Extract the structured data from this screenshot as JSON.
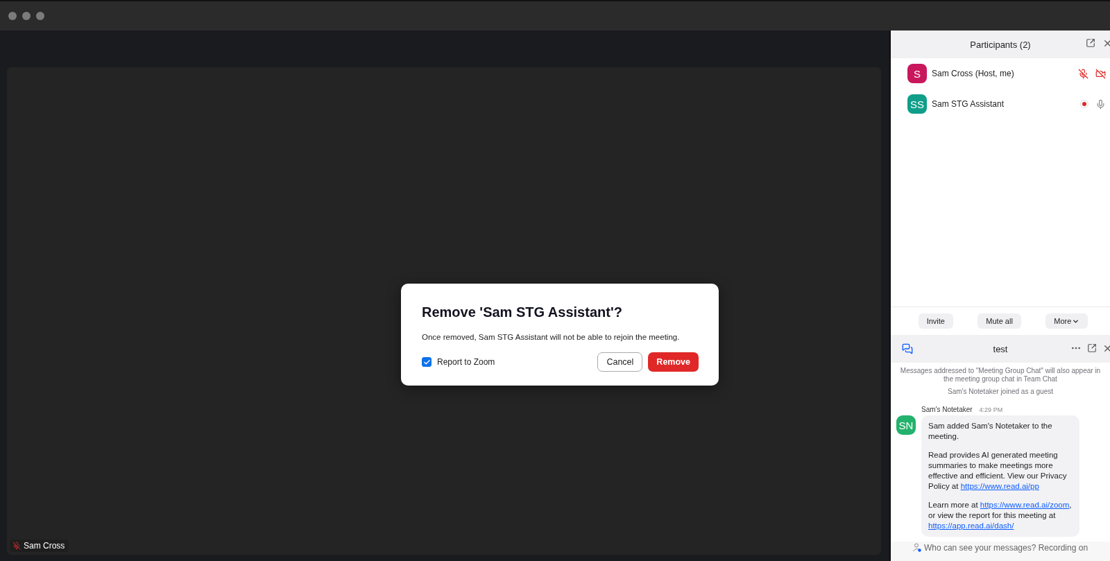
{
  "video": {
    "name": "Sam Cross",
    "muted": true
  },
  "dialog": {
    "title": "Remove 'Sam STG Assistant'?",
    "message": "Once removed, Sam STG Assistant will not be able to rejoin the meeting.",
    "checkbox": {
      "label": "Report to Zoom",
      "checked": true
    },
    "buttons": [
      {
        "label": "Cancel",
        "kind": "secondary"
      },
      {
        "label": "Remove",
        "kind": "danger"
      }
    ]
  },
  "participants": {
    "title": "Participants (2)",
    "items": [
      {
        "initials": "S",
        "name": "Sam Cross (Host, me)",
        "color": "#c8175d",
        "recording": false,
        "muted": true,
        "video_off": true
      },
      {
        "initials": "SS",
        "name": "Sam STG Assistant",
        "color": "#0e9e8a",
        "recording": true,
        "muted": false,
        "video_off": false
      }
    ],
    "buttons": [
      {
        "label": "Invite",
        "dropdown": false
      },
      {
        "label": "Mute all",
        "dropdown": false
      },
      {
        "label": "More",
        "dropdown": true
      }
    ]
  },
  "chat": {
    "title": "test",
    "notices": [
      "Messages addressed to \"Meeting Group Chat\" will also appear in the meeting group chat in Team Chat",
      "Sam's Notetaker joined as a guest"
    ],
    "messages": [
      {
        "initials": "SN",
        "color": "#23b26d",
        "sender": "Sam's Notetaker",
        "time": "4:29 PM",
        "paragraphs": [
          [
            {
              "text": "Sam added Sam's Notetaker to the meeting.",
              "link": false
            }
          ],
          [
            {
              "text": "Read provides AI generated meeting summaries to make meetings more effective and efficient. View our Privacy Policy at ",
              "link": false
            },
            {
              "text": "https://www.read.ai/pp",
              "link": true
            }
          ],
          [
            {
              "text": "Learn more at ",
              "link": false
            },
            {
              "text": "https://www.read.ai/zoom",
              "link": true
            },
            {
              "text": ", or view the report for this meeting at ",
              "link": false
            },
            {
              "text": "https://app.read.ai/dash/",
              "link": true
            }
          ]
        ]
      }
    ],
    "footer": "Who can see your messages? Recording on"
  }
}
